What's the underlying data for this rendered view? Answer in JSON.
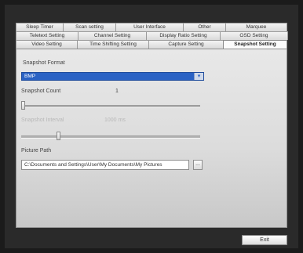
{
  "tabs": {
    "row1": [
      "Sleep Timer",
      "Scan setting",
      "User Interface",
      "Other",
      "Marquee"
    ],
    "row2": [
      "Teletext Setting",
      "Channel Setting",
      "Display Ratio Setting",
      "OSD Setting"
    ],
    "row3": [
      "Video Setting",
      "Time Shifting Setting",
      "Capture Setting",
      "Snapshot Setting"
    ],
    "active": "Snapshot Setting"
  },
  "snapshot": {
    "format_label": "Snapshot Format",
    "format_value": "BMP",
    "count_label": "Snapshot Count",
    "count_value": "1",
    "count_level": 0.0,
    "interval_label": "Snapshot Interval",
    "interval_value": "1000 ms",
    "interval_level": 0.2,
    "path_label": "Picture Path",
    "path_value": "C:\\Documents and Settings\\User\\My Documents\\My Pictures",
    "browse_label": "..."
  },
  "footer": {
    "exit_label": "Exit"
  },
  "colors": {
    "select_highlight": "#2a62c4",
    "background": "#2a2a2a"
  }
}
